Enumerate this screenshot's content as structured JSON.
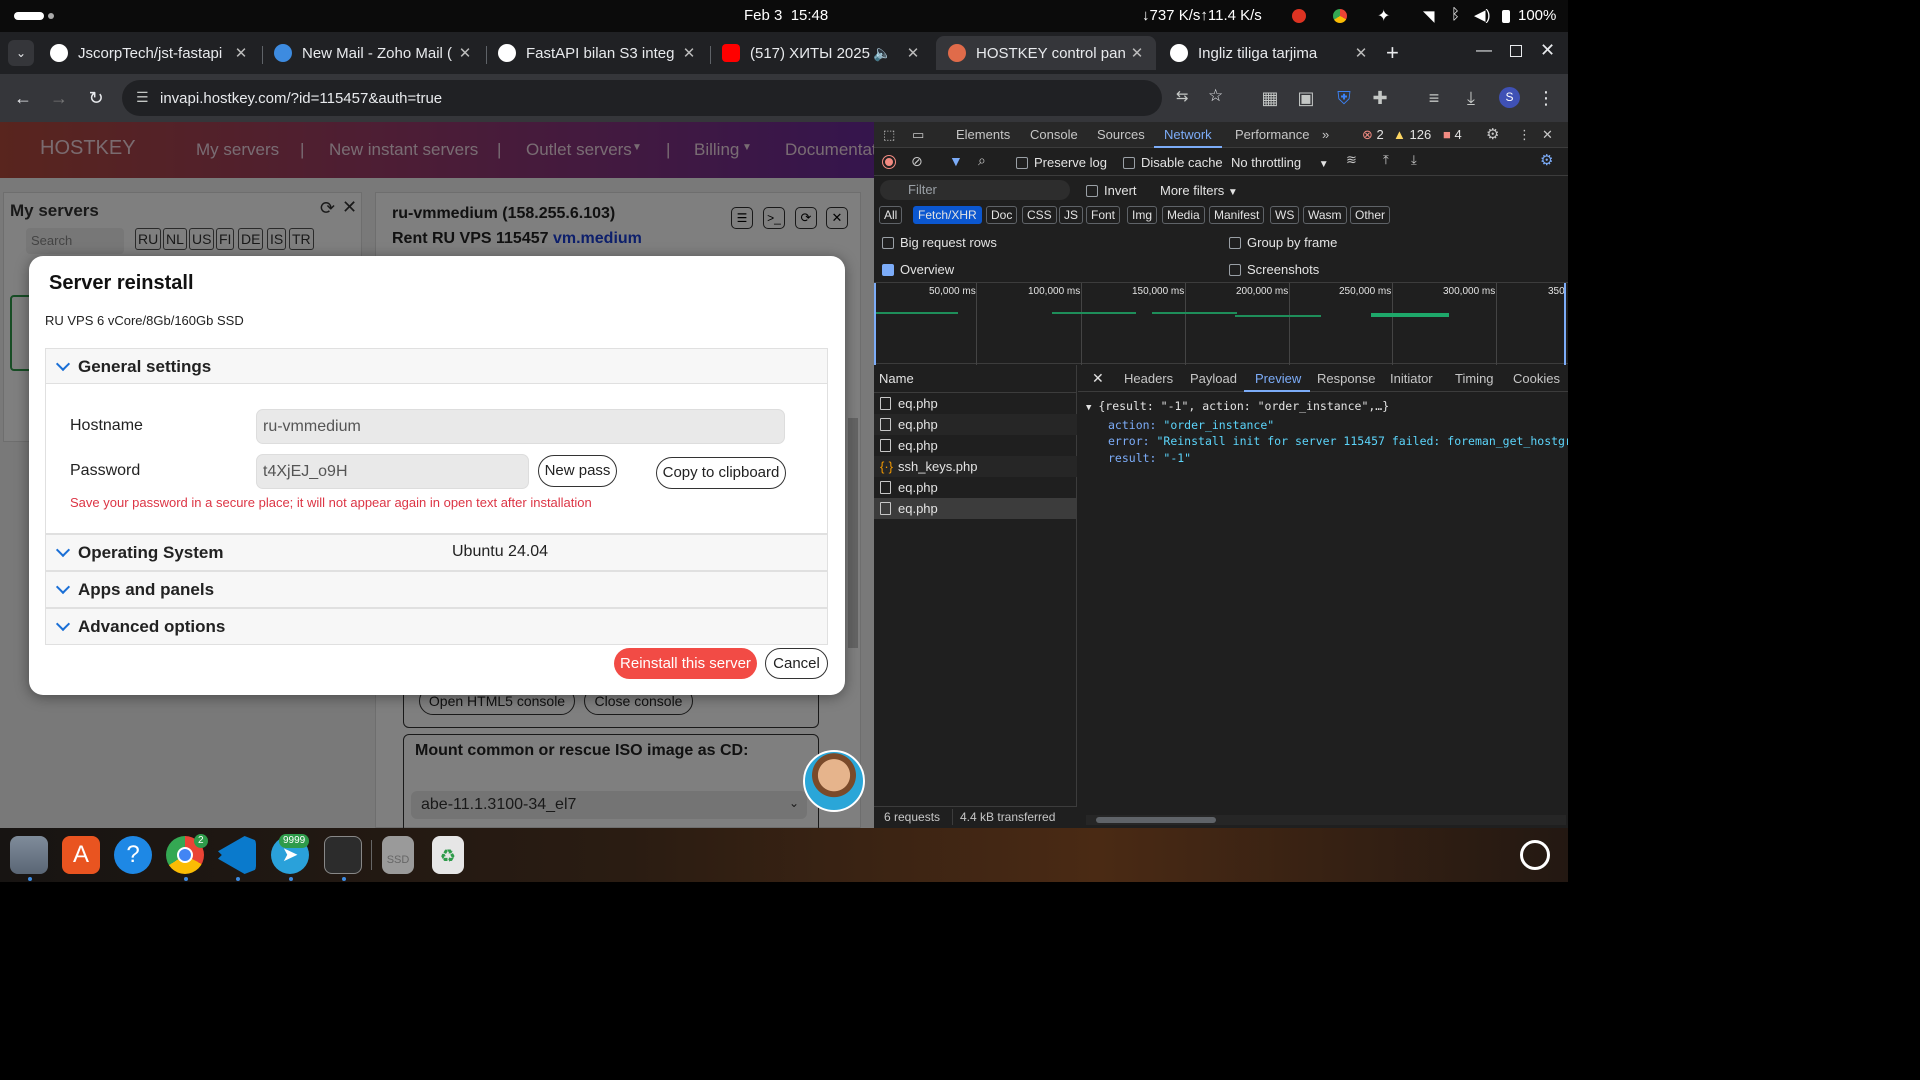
{
  "system": {
    "date": "Feb 3",
    "time": "15:48",
    "net": "↓737 K/s↑11.4 K/s",
    "battery": "100%"
  },
  "tabs": [
    {
      "title": "JscorpTech/jst-fastapi",
      "color": "#ffffff"
    },
    {
      "title": "New Mail - Zoho Mail (",
      "color": "#3d8be0"
    },
    {
      "title": "FastAPI bilan S3 integ",
      "color": "#cccccc"
    },
    {
      "title": "(517) ХИТЫ 2025",
      "color": "#ff0000"
    },
    {
      "title": "HOSTKEY control pan",
      "color": "#e06b4a"
    },
    {
      "title": "Ingliz tiliga tarjima",
      "color": "#cccccc"
    }
  ],
  "url": "invapi.hostkey.com/?id=115457&auth=true",
  "site": {
    "brand": "HOSTKEY",
    "nav": [
      "My servers",
      "|",
      "New instant servers",
      "|",
      "Outlet servers",
      "|",
      "Billing",
      "Documentat"
    ],
    "my_servers": {
      "title": "My servers",
      "search_placeholder": "Search",
      "filters": [
        "RU",
        "NL",
        "US",
        "FI",
        "DE",
        "IS",
        "TR"
      ]
    },
    "server": {
      "name": "ru-vmmedium (158.255.6.103)",
      "rent": "Rent RU VPS 115457",
      "plan": "vm.medium"
    },
    "console": {
      "open": "Open HTML5 console",
      "close": "Close console"
    },
    "iso": {
      "title": "Mount common or rescue ISO image as CD:",
      "value": "abe-11.1.3100-34_el7"
    }
  },
  "modal": {
    "title": "Server reinstall",
    "subtitle": "RU VPS 6 vCore/8Gb/160Gb SSD",
    "general": "General settings",
    "hostname_label": "Hostname",
    "hostname": "ru-vmmedium",
    "password_label": "Password",
    "password": "t4XjEJ_o9H",
    "new_pass": "New pass",
    "copy": "Copy to clipboard",
    "warning": "Save your password in a secure place; it will not appear again in open text after installation",
    "os_label": "Operating System",
    "os_value": "Ubuntu 24.04",
    "apps": "Apps and panels",
    "advanced": "Advanced options",
    "reinstall": "Reinstall this server",
    "cancel": "Cancel"
  },
  "devtools": {
    "tabs": [
      "Elements",
      "Console",
      "Sources",
      "Network",
      "Performance"
    ],
    "errors": "2",
    "warnings": "126",
    "issues": "4",
    "preserve": "Preserve log",
    "disable_cache": "Disable cache",
    "throttle": "No throttling",
    "filter_placeholder": "Filter",
    "invert": "Invert",
    "more_filters": "More filters",
    "types": [
      "All",
      "Fetch/XHR",
      "Doc",
      "CSS",
      "JS",
      "Font",
      "Img",
      "Media",
      "Manifest",
      "WS",
      "Wasm",
      "Other"
    ],
    "big_rows": "Big request rows",
    "group_frame": "Group by frame",
    "overview": "Overview",
    "screenshots": "Screenshots",
    "timeline": [
      "50,000 ms",
      "100,000 ms",
      "150,000 ms",
      "200,000 ms",
      "250,000 ms",
      "300,000 ms",
      "350"
    ],
    "name_header": "Name",
    "requests": [
      "eq.php",
      "eq.php",
      "eq.php",
      "ssh_keys.php",
      "eq.php",
      "eq.php"
    ],
    "detail_tabs": [
      "Headers",
      "Payload",
      "Preview",
      "Response",
      "Initiator",
      "Timing",
      "Cookies"
    ],
    "preview": {
      "summary": "{result: \"-1\", action: \"order_instance\",…}",
      "action_key": "action:",
      "action_val": "\"order_instance\"",
      "error_key": "error:",
      "error_val": "\"Reinstall init for server 115457 failed: foreman_get_hostgro",
      "result_key": "result:",
      "result_val": "\"-1\""
    },
    "status": {
      "requests": "6 requests",
      "transferred": "4.4 kB transferred"
    }
  },
  "dock": {
    "chrome_badge": "2",
    "telegram_badge": "9999",
    "ssd": "SSD"
  }
}
